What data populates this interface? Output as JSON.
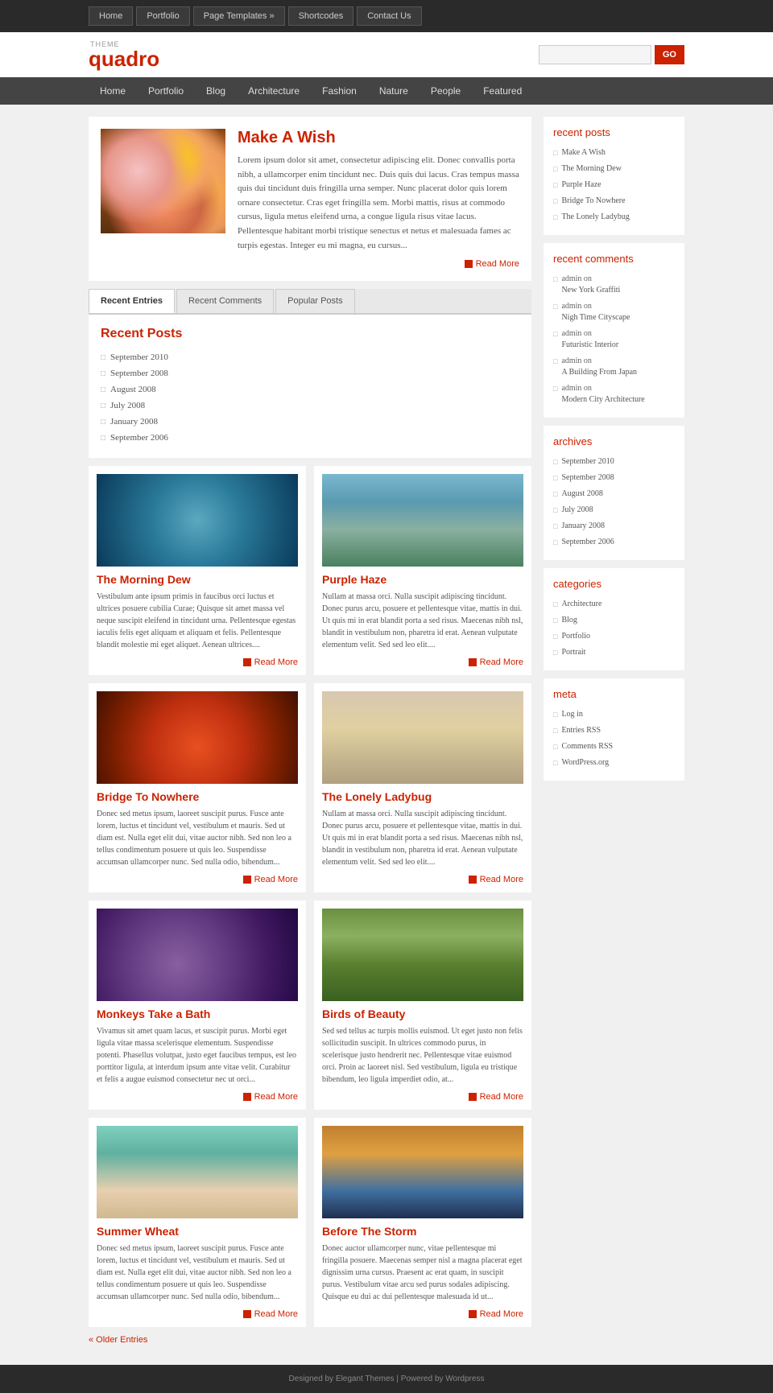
{
  "topnav": {
    "items": [
      {
        "label": "Home",
        "arrow": false
      },
      {
        "label": "Portfolio",
        "arrow": false
      },
      {
        "label": "Page Templates »",
        "arrow": false
      },
      {
        "label": "Shortcodes",
        "arrow": false
      },
      {
        "label": "Contact Us",
        "arrow": false
      }
    ]
  },
  "logo": {
    "theme": "THEME",
    "name_black": "quad",
    "name_red": "ro"
  },
  "search": {
    "placeholder": "",
    "btn_label": "GO"
  },
  "mainnav": {
    "items": [
      "Home",
      "Portfolio",
      "Blog",
      "Architecture",
      "Fashion",
      "Nature",
      "People",
      "Featured"
    ]
  },
  "featured": {
    "title": "Make A Wish",
    "body": "Lorem ipsum dolor sit amet, consectetur adipiscing elit. Donec convallis porta nibh, a ullamcorper enim tincidunt nec. Duis quis dui lacus. Cras tempus massa quis dui tincidunt duis fringilla urna semper. Nunc placerat dolor quis lorem ornare consectetur. Cras eget fringilla sem. Morbi mattis, risus at commodo cursus, ligula metus eleifend urna, a congue ligula risus vitae lacus. Pellentesque habitant morbi tristique senectus et netus et malesuada fames ac turpis egestas. Integer eu mi magna, eu cursus...",
    "read_more": "Read More"
  },
  "tabs": {
    "items": [
      "Recent Entries",
      "Recent Comments",
      "Popular Posts"
    ],
    "active": 0
  },
  "recent_posts_section": {
    "title": "Recent Posts",
    "items": [
      "September 2010",
      "September 2008",
      "August 2008",
      "July 2008",
      "January 2008",
      "September 2006"
    ]
  },
  "posts": [
    {
      "title": "The Morning Dew",
      "body": "Vestibulum ante ipsum primis in faucibus orci luctus et ultrices posuere cubilia Curae; Quisque sit amet massa vel neque suscipit eleifend in tincidunt urna. Pellentesque egestas iaculis felis eget aliquam et aliquam et felis. Pellentesque blandit molestie mi eget aliquet. Aenean ultrices....",
      "read_more": "Read More",
      "img_class": "post-img-morning-dew"
    },
    {
      "title": "Purple Haze",
      "body": "Nullam at massa orci. Nulla suscipit adipiscing tincidunt. Donec purus arcu, posuere et pellentesque vitae, mattis in dui. Ut quis mi in erat blandit porta a sed risus. Maecenas nibh nsl, blandit in vestibulum non, pharetra id erat. Aenean vulputate elementum velit. Sed sed leo elit....",
      "read_more": "Read More",
      "img_class": "post-img-purple-haze"
    },
    {
      "title": "Bridge To Nowhere",
      "body": "Donec sed metus ipsum, laoreet suscipit purus. Fusce ante lorem, luctus et tincidunt vel, vestibulum et mauris. Sed ut diam est. Nulla eget elit dui, vitae auctor nibh. Sed non leo a tellus condimentum posuere ut quis leo. Suspendisse accumsan ullamcorper nunc. Sed nulla odio, bibendum...",
      "read_more": "Read More",
      "img_class": "post-img-bridge"
    },
    {
      "title": "The Lonely Ladybug",
      "body": "Nullam at massa orci. Nulla suscipit adipiscing tincidunt. Donec purus arcu, posuere et pellentesque vitae, mattis in dui. Ut quis mi in erat blandit porta a sed risus. Maecenas nibh nsl, blandit in vestibulum non, pharetra id erat. Aenean vulputate elementum velit. Sed sed leo elit....",
      "read_more": "Read More",
      "img_class": "post-img-ladybug"
    },
    {
      "title": "Monkeys Take a Bath",
      "body": "Vivamus sit amet quam lacus, et suscipit purus. Morbi eget ligula vitae massa scelerisque elementum. Suspendisse potenti. Phasellus volutpat, justo eget faucibus tempus, est leo porttitor ligula, at interdum ipsum ante vitae velit. Curabitur et felis a augue euismod consectetur nec ut orci...",
      "read_more": "Read More",
      "img_class": "post-img-monkeys"
    },
    {
      "title": "Birds of Beauty",
      "body": "Sed sed tellus ac turpis mollis euismod. Ut eget justo non felis sollicitudin suscipit. In ultrices commodo purus, in scelerisque justo hendrerit nec. Pellentesque vitae euismod orci. Proin ac laoreet nisl. Sed vestibulum, ligula eu tristique bibendum, leo ligula imperdiet odio, at...",
      "read_more": "Read More",
      "img_class": "post-img-birds"
    },
    {
      "title": "Summer Wheat",
      "body": "Donec sed metus ipsum, laoreet suscipit purus. Fusce ante lorem, luctus et tincidunt vel, vestibulum et mauris. Sed ut diam est. Nulla eget elit dui, vitae auctor nibh. Sed non leo a tellus condimentum posuere ut quis leo. Suspendisse accumsan ullamcorper nunc. Sed nulla odio, bibendum...",
      "read_more": "Read More",
      "img_class": "post-img-summer"
    },
    {
      "title": "Before The Storm",
      "body": "Donec auctor ullamcorper nunc, vitae pellentesque mi fringilla posuere. Maecenas semper nisl a magna placerat eget dignissim urna cursus. Praesent ac erat quam, in suscipit purus. Vestibulum vitae arcu sed purus sodales adipiscing. Quisque eu dui ac dui pellentesque malesuada id ut...",
      "read_more": "Read More",
      "img_class": "post-img-storm"
    }
  ],
  "sidebar": {
    "recent_posts": {
      "title": "recent posts",
      "items": [
        "Make A Wish",
        "The Morning Dew",
        "Purple Haze",
        "Bridge To Nowhere",
        "The Lonely Ladybug"
      ]
    },
    "recent_comments": {
      "title": "recent comments",
      "items": [
        {
          "author": "admin on",
          "post": "New York Graffiti"
        },
        {
          "author": "admin on",
          "post": "Nigh Time Cityscape"
        },
        {
          "author": "admin on",
          "post": "Futuristic Interior"
        },
        {
          "author": "admin on",
          "post": "A Building From Japan"
        },
        {
          "author": "admin on",
          "post": "Modern City Architecture"
        }
      ]
    },
    "archives": {
      "title": "archives",
      "items": [
        "September 2010",
        "September 2008",
        "August 2008",
        "July 2008",
        "January 2008",
        "September 2006"
      ]
    },
    "categories": {
      "title": "categories",
      "items": [
        "Architecture",
        "Blog",
        "Portfolio",
        "Portrait"
      ]
    },
    "meta": {
      "title": "meta",
      "items": [
        "Log in",
        "Entries RSS",
        "Comments RSS",
        "WordPress.org"
      ]
    }
  },
  "older_entries": "« Older Entries",
  "footer": {
    "text": "Designed by Elegant Themes | Powered by Wordpress"
  }
}
